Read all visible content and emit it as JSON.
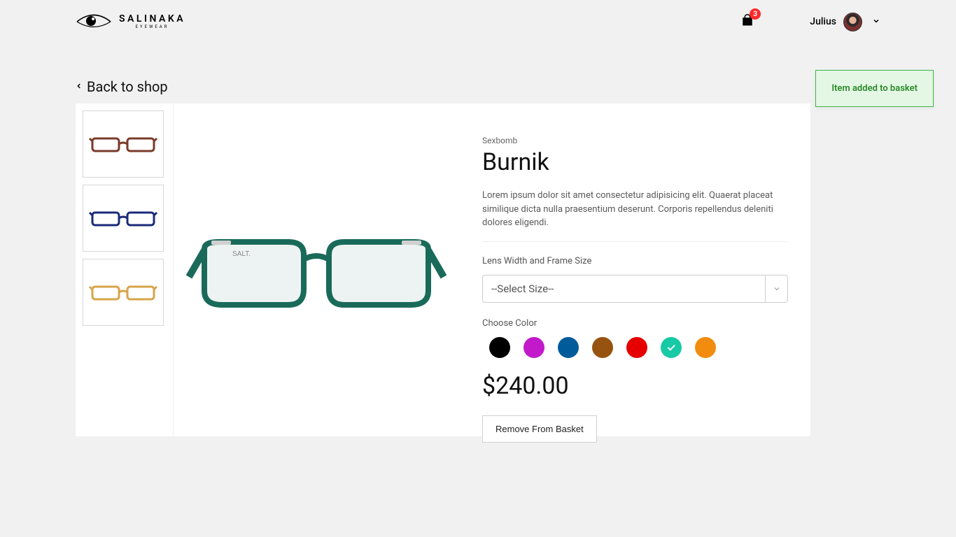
{
  "header": {
    "brand": "SALINAKA",
    "brand_sub": "EYEWEAR",
    "cart_count": "3",
    "username": "Julius"
  },
  "back_label": "Back to shop",
  "toast": {
    "message": "Item added to basket"
  },
  "product": {
    "brand_tag": "Sexbomb",
    "name": "Burnik",
    "description": "Lorem ipsum dolor sit amet consectetur adipisicing elit. Quaerat placeat similique dicta nulla praesentium deserunt. Corporis repellendus deleniti dolores eligendi.",
    "size_label": "Lens Width and Frame Size",
    "size_placeholder": "--Select Size--",
    "color_label": "Choose Color",
    "colors": [
      {
        "name": "black",
        "hex": "#000000",
        "selected": false
      },
      {
        "name": "purple",
        "hex": "#c21acb",
        "selected": false
      },
      {
        "name": "blue",
        "hex": "#005b9a",
        "selected": false
      },
      {
        "name": "brown",
        "hex": "#96530f",
        "selected": false
      },
      {
        "name": "red",
        "hex": "#e60000",
        "selected": false
      },
      {
        "name": "teal",
        "hex": "#17c9a4",
        "selected": true
      },
      {
        "name": "orange",
        "hex": "#f28c0f",
        "selected": false
      }
    ],
    "price": "$240.00",
    "remove_label": "Remove From Basket"
  },
  "thumbs": [
    {
      "frame_color": "#7a3a2a"
    },
    {
      "frame_color": "#1a2a7a"
    },
    {
      "frame_color": "#d8a44a"
    }
  ],
  "main_image": {
    "frame_color": "#1a6a5a"
  }
}
